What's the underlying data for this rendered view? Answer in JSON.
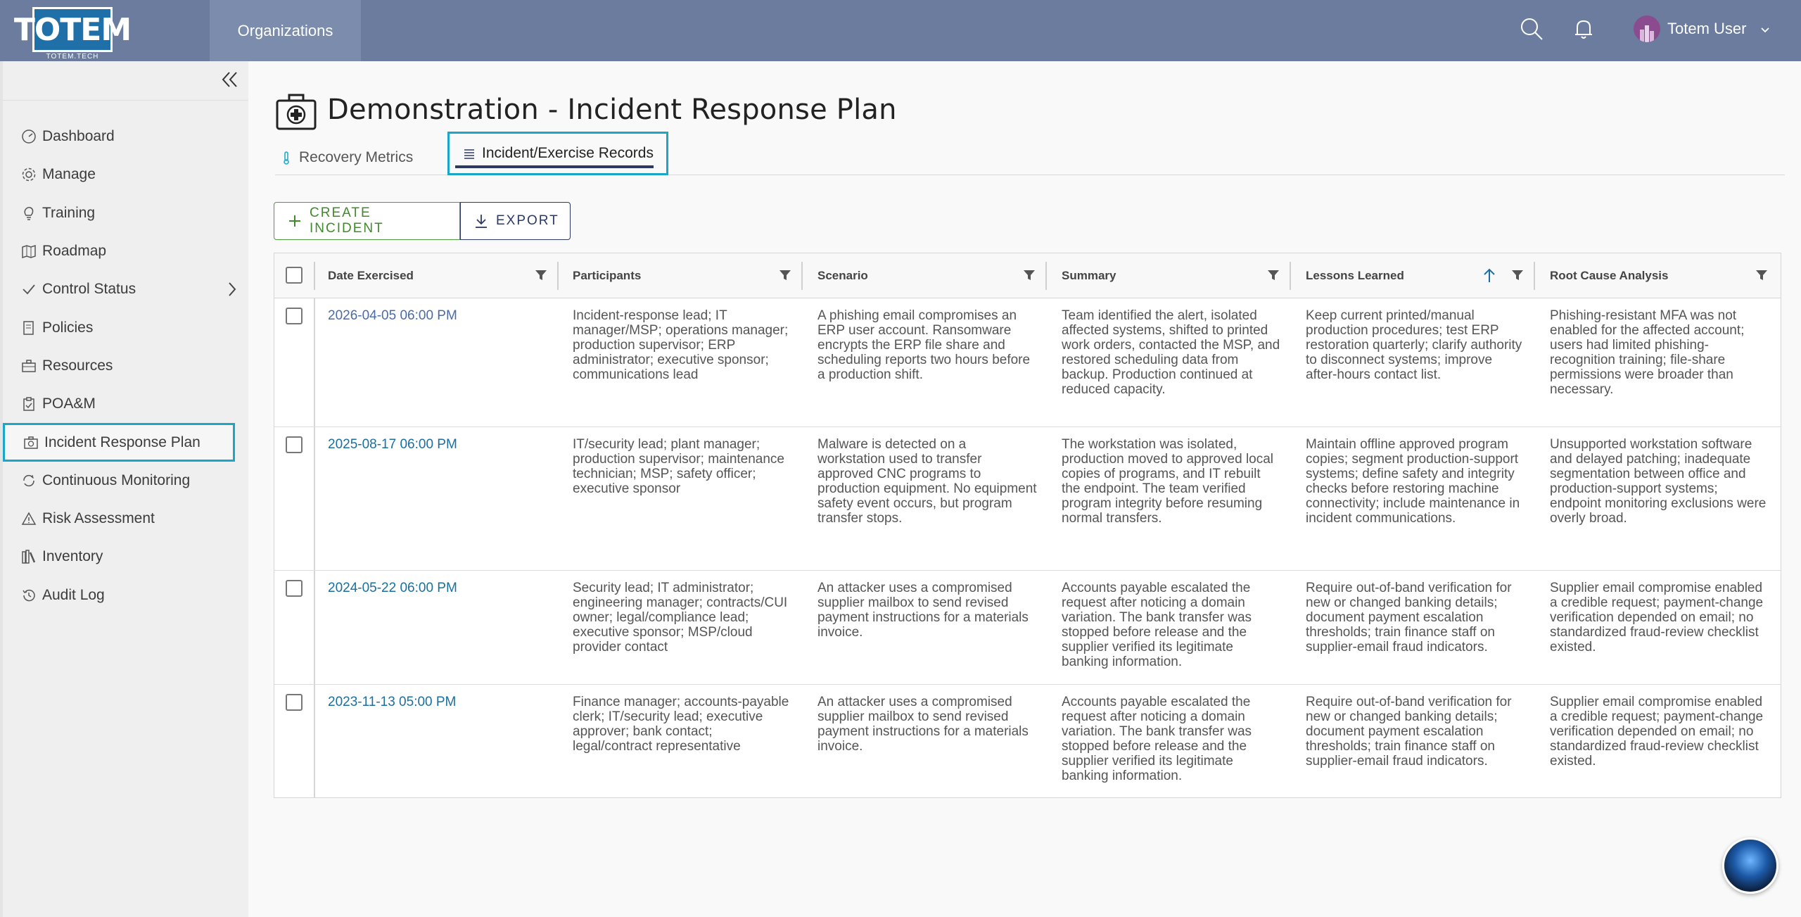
{
  "topbar": {
    "logo_text": "TOTEM",
    "logo_sub": "TOTEM.TECH",
    "org_tab": "Organizations",
    "user_name": "Totem User",
    "colors": {
      "bar": "#6b7c9e",
      "tab": "#7b8cac"
    }
  },
  "sidebar": {
    "items": [
      {
        "label": "Dashboard",
        "icon": "dashboard-gauge-icon"
      },
      {
        "label": "Manage",
        "icon": "gear-icon"
      },
      {
        "label": "Training",
        "icon": "lightbulb-icon"
      },
      {
        "label": "Roadmap",
        "icon": "map-icon"
      },
      {
        "label": "Control Status",
        "icon": "check-icon"
      },
      {
        "label": "Policies",
        "icon": "document-icon"
      },
      {
        "label": "Resources",
        "icon": "briefcase-icon"
      },
      {
        "label": "POA&M",
        "icon": "clipboard-icon"
      },
      {
        "label": "Incident Response Plan",
        "icon": "medical-kit-icon"
      },
      {
        "label": "Continuous Monitoring",
        "icon": "cycle-icon"
      },
      {
        "label": "Risk Assessment",
        "icon": "warning-icon"
      },
      {
        "label": "Inventory",
        "icon": "books-icon"
      },
      {
        "label": "Audit Log",
        "icon": "history-icon"
      }
    ],
    "active_index": 8
  },
  "page": {
    "title": "Demonstration - Incident Response Plan",
    "tabs": [
      {
        "label": "Recovery Metrics",
        "icon": "thermometer-icon"
      },
      {
        "label": "Incident/Exercise Records",
        "icon": "list-icon"
      }
    ],
    "active_tab": 1
  },
  "toolbar": {
    "create_label": "CREATE INCIDENT",
    "export_label": "EXPORT"
  },
  "table": {
    "columns": [
      "Date Exercised",
      "Participants",
      "Scenario",
      "Summary",
      "Lessons Learned",
      "Root Cause Analysis"
    ],
    "sorted_column": "Lessons Learned",
    "rows": [
      {
        "date": "2026-04-05 06:00 PM",
        "participants": "Incident-response lead; IT manager/MSP; operations manager; production supervisor; ERP administrator; executive sponsor; communications lead",
        "scenario": "A phishing email compromises an ERP user account. Ransomware encrypts the ERP file share and scheduling reports two hours before a production shift.",
        "summary": "Team identified the alert, isolated affected systems, shifted to printed work orders, contacted the MSP, and restored scheduling data from backup. Production continued at reduced capacity.",
        "lessons": "Keep current printed/manual production procedures; test ERP restoration quarterly; clarify authority to disconnect systems; improve after-hours contact list.",
        "root_cause": "Phishing-resistant MFA was not enabled for the affected account; users had limited phishing-recognition training; file-share permissions were broader than necessary."
      },
      {
        "date": "2025-08-17 06:00 PM",
        "participants": "IT/security lead; plant manager; production supervisor; maintenance technician; MSP; safety officer; executive sponsor",
        "scenario": "Malware is detected on a workstation used to transfer approved CNC programs to production equipment. No equipment safety event occurs, but program transfer stops.",
        "summary": "The workstation was isolated, production moved to approved local copies of programs, and IT rebuilt the endpoint. The team verified program integrity before resuming normal transfers.",
        "lessons": "Maintain offline approved program copies; segment production-support systems; define safety and integrity checks before restoring machine connectivity; include maintenance in incident communications.",
        "root_cause": "Unsupported workstation software and delayed patching; inadequate segmentation between office and production-support systems; endpoint monitoring exclusions were overly broad."
      },
      {
        "date": "2024-05-22 06:00 PM",
        "participants": "Security lead; IT administrator; engineering manager; contracts/CUI owner; legal/compliance lead; executive sponsor; MSP/cloud provider contact",
        "scenario": "An attacker uses a compromised supplier mailbox to send revised payment instructions for a materials invoice.",
        "summary": "Accounts payable escalated the request after noticing a domain variation. The bank transfer was stopped before release and the supplier verified its legitimate banking information.",
        "lessons": "Require out-of-band verification for new or changed banking details; document payment escalation thresholds; train finance staff on supplier-email fraud indicators.",
        "root_cause": "Supplier email compromise enabled a credible request; payment-change verification depended on email; no standardized fraud-review checklist existed."
      },
      {
        "date": "2023-11-13 05:00 PM",
        "participants": "Finance manager; accounts-payable clerk; IT/security lead; executive approver; bank contact; legal/contract representative",
        "scenario": "An attacker uses a compromised supplier mailbox to send revised payment instructions for a materials invoice.",
        "summary": "Accounts payable escalated the request after noticing a domain variation. The bank transfer was stopped before release and the supplier verified its legitimate banking information.",
        "lessons": "Require out-of-band verification for new or changed banking details; document payment escalation thresholds; train finance staff on supplier-email fraud indicators.",
        "root_cause": "Supplier email compromise enabled a credible request; payment-change verification depended on email; no standardized fraud-review checklist existed."
      }
    ]
  },
  "colors": {
    "accent": "#1aa6c8",
    "link": "#1a6fa0",
    "create": "#3f8a2a",
    "navy": "#2c3a63"
  }
}
